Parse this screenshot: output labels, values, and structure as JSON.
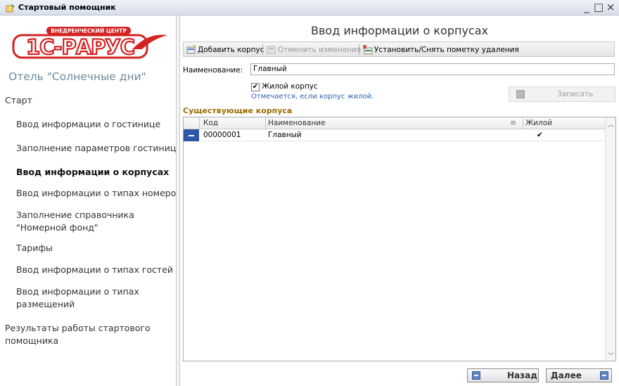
{
  "window": {
    "title": "Стартовый помощник",
    "minimize": "_",
    "maximize": "□",
    "close": "×"
  },
  "logo": {
    "badge": "ВНЕДРЕНЧЕСКИЙ ЦЕНТР",
    "text": "1С-Рарус",
    "brand_color": "#d22222"
  },
  "hotel_name": "Отель \"Солнечные дни\"",
  "nav": {
    "start": "Старт",
    "items": [
      "Ввод информации о гостинице",
      "Заполнение параметров гостиниц",
      "Ввод информации о корпусах",
      "Ввод информации о типах номеров",
      "Заполнение справочника \"Номерной фонд\"",
      "Тарифы",
      "Ввод информации о типах гостей",
      "Ввод информации о типах размещений"
    ],
    "results": "Результаты работы стартового помощника"
  },
  "form": {
    "title": "Ввод информации о корпусах",
    "toolbar": {
      "add": "Добавить корпус",
      "cancel": "Отменить изменения",
      "mark_delete": "Установить/Снять пометку удаления"
    },
    "name_label": "Наименование:",
    "name_value": "Главный",
    "residential_label": "Жилой корпус",
    "residential_checked": true,
    "residential_hint": "Отмечается, если корпус жилой.",
    "save": "Записать",
    "section_title": "Существующие корпуса",
    "table": {
      "columns": [
        "Код",
        "Наименование",
        "Жилой"
      ],
      "rows": [
        {
          "code": "00000001",
          "name": "Главный",
          "residential": "✔"
        }
      ]
    },
    "back": "Назад",
    "next": "Далее"
  }
}
